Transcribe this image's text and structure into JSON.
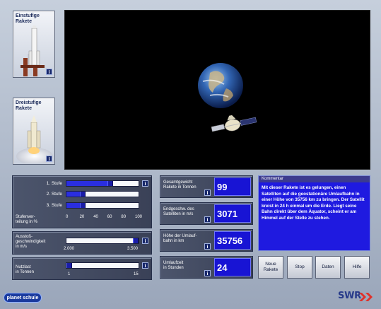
{
  "rockets": [
    {
      "label": "Einstufige Rakete",
      "info": "i"
    },
    {
      "label": "Dreistufige Rakete",
      "info": "i"
    }
  ],
  "stages": {
    "rows": [
      {
        "label": "1. Stufe",
        "value_percent": 60
      },
      {
        "label": "2. Stufe",
        "value_percent": 20
      },
      {
        "label": "3. Stufe",
        "value_percent": 20
      }
    ],
    "caption": "Stufenver-\nteilung in %",
    "scale": [
      "0",
      "20",
      "40",
      "60",
      "80",
      "100"
    ],
    "info": "i"
  },
  "exhaust": {
    "caption": "Ausstoß-\ngeschwindigkeit\nin m/s",
    "min": "2.000",
    "max": "3.500",
    "value_fraction": 1.0,
    "info": "i"
  },
  "payload": {
    "caption": "Nutzlast\nin Tonnen",
    "min": "1",
    "max": "15",
    "value_fraction": 0.0,
    "info": "i"
  },
  "readouts": [
    {
      "label": "Gesamtgewicht\nRakete in Tonnen",
      "value": "99",
      "info": "i"
    },
    {
      "label": "Endgeschw. des\nSatelliten in m/s",
      "value": "3071",
      "info": "i"
    },
    {
      "label": "Höhe der Umlauf-\nbahn in km",
      "value": "35756",
      "info": "i"
    },
    {
      "label": "Umlaufzeit\nin Stunden",
      "value": "24",
      "info": "i"
    }
  ],
  "comment": {
    "title": "Kommentar",
    "text": "Mit dieser Rakete ist es gelungen, einen Satelliten auf die geostationäre Umlaufbahn in einer Höhe von 35756 km zu bringen. Der Satellit kreist in 24 h einmal um die Erde. Liegt seine Bahn direkt über dem Äquator, scheint er am Himmel auf der Stelle zu stehen."
  },
  "buttons": {
    "new_rocket": "Neue\nRakete",
    "stop": "Stop",
    "data": "Daten",
    "help": "Hilfe"
  },
  "footer": {
    "planet_logo": "planet schule",
    "swr_logo": "SWR"
  },
  "colors": {
    "accent_blue": "#1814d4",
    "panel_gray": "#4c556c",
    "swr_red": "#e0312a"
  }
}
